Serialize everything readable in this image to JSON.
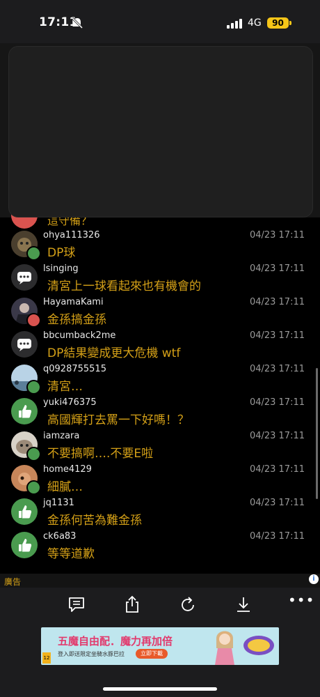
{
  "status_bar": {
    "time": "17:11",
    "network": "4G",
    "battery": "90"
  },
  "partial_comment": {
    "text": "這守備？"
  },
  "comments": [
    {
      "user": "ohya111326",
      "time": "04/23 17:11",
      "text": "DP球"
    },
    {
      "user": "lsinging",
      "time": "04/23 17:11",
      "text": "清宮上一球看起來也有機會的"
    },
    {
      "user": "HayamaKami",
      "time": "04/23 17:11",
      "text": "金孫搞金孫"
    },
    {
      "user": "bbcumback2me",
      "time": "04/23 17:11",
      "text": "DP結果變成更大危機 wtf"
    },
    {
      "user": "q0928755515",
      "time": "04/23 17:11",
      "text": "清宮…"
    },
    {
      "user": "yuki476375",
      "time": "04/23 17:11",
      "text": "高國輝打去罵一下好嗎！？"
    },
    {
      "user": "iamzara",
      "time": "04/23 17:11",
      "text": "不要搞啊….不要E啦"
    },
    {
      "user": "home4129",
      "time": "04/23 17:11",
      "text": "細膩…"
    },
    {
      "user": "jq1131",
      "time": "04/23 17:11",
      "text": "金孫何苦為難金孫"
    },
    {
      "user": "ck6a83",
      "time": "04/23 17:11",
      "text": "等等道歉"
    }
  ],
  "ad": {
    "label": "廣告",
    "info": "i",
    "banner_title": "五魔自由配．魔力再加倍",
    "banner_sub": "登入即送限定坐騎水豚巴拉",
    "banner_button": "立即下載",
    "banner_rating": "12"
  },
  "toolbar": {
    "more": "•••"
  },
  "colors": {
    "comment_text": "#d4a017",
    "up_badge": "#4a9b4f",
    "down_badge": "#d9534f",
    "background": "#000000"
  }
}
